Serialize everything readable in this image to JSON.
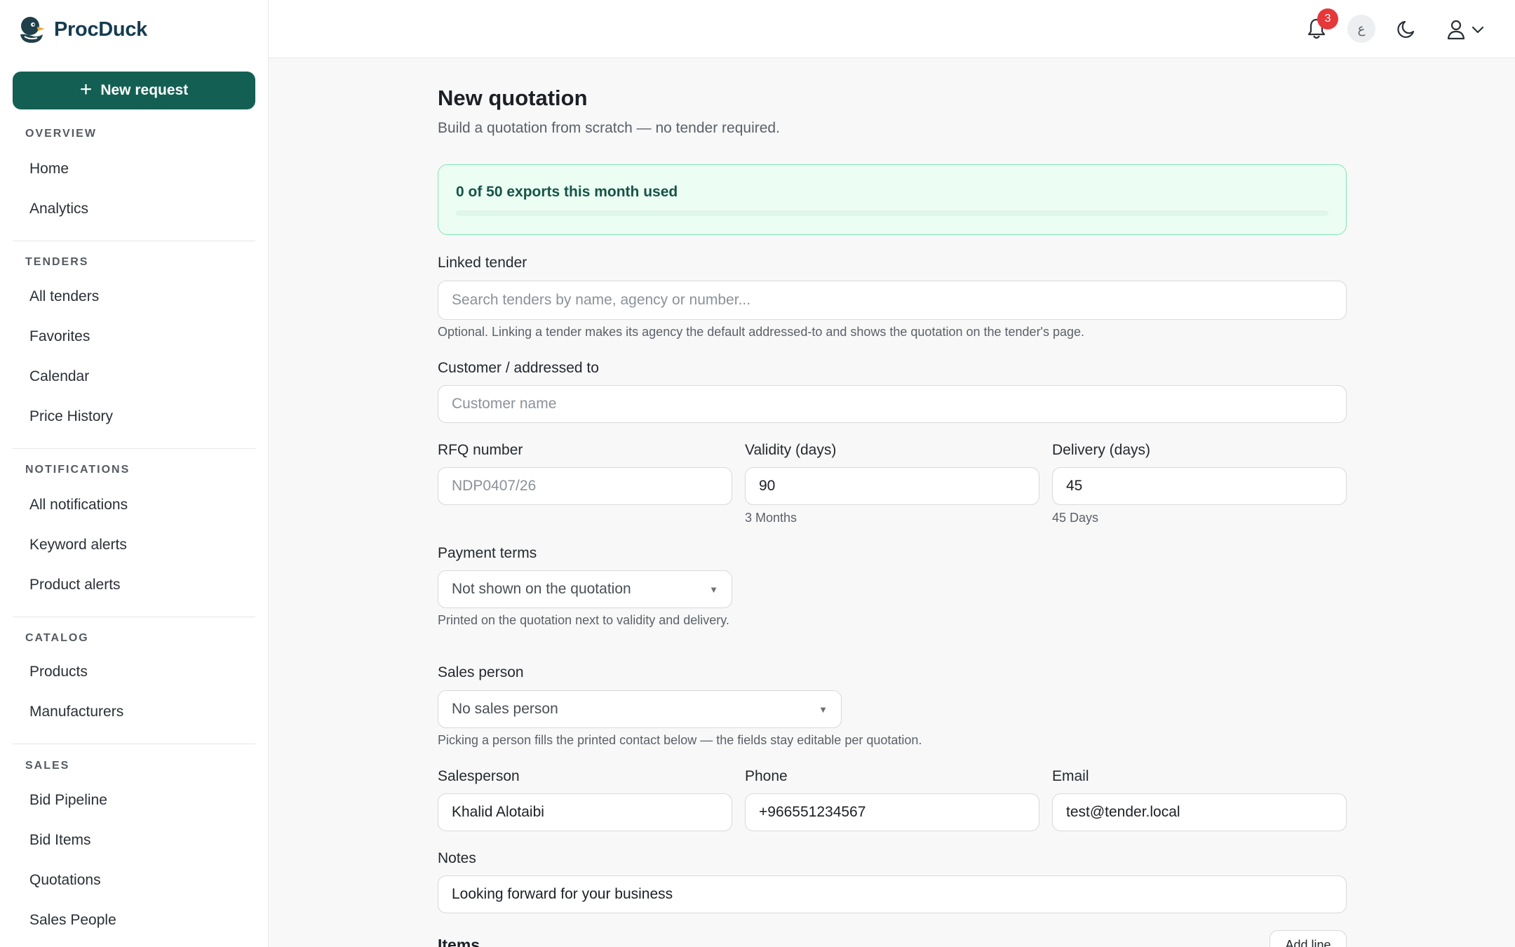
{
  "app": {
    "name": "ProcDuck",
    "logo_icon": "duck-logo-icon"
  },
  "sidebar": {
    "new_request_label": "New request",
    "sections": [
      {
        "title": "OVERVIEW",
        "items": [
          "Home",
          "Analytics"
        ]
      },
      {
        "title": "TENDERS",
        "items": [
          "All tenders",
          "Favorites",
          "Calendar",
          "Price History"
        ]
      },
      {
        "title": "NOTIFICATIONS",
        "items": [
          "All notifications",
          "Keyword alerts",
          "Product alerts"
        ]
      },
      {
        "title": "CATALOG",
        "items": [
          "Products",
          "Manufacturers"
        ]
      },
      {
        "title": "SALES",
        "items": [
          "Bid Pipeline",
          "Bid Items",
          "Quotations",
          "Sales People"
        ]
      }
    ]
  },
  "topbar": {
    "notification_count": "3",
    "language_label": "ع",
    "icons": [
      "bell-icon",
      "moon-icon",
      "user-icon",
      "chevron-down-icon"
    ]
  },
  "page": {
    "title": "New quotation",
    "subtitle": "Build a quotation from scratch — no tender required."
  },
  "quota": {
    "text": "0 of 50 exports this month used",
    "used": 0,
    "limit": 50
  },
  "form": {
    "linked_tender": {
      "label": "Linked tender",
      "placeholder": "Search tenders by name, agency or number...",
      "help": "Optional. Linking a tender makes its agency the default addressed-to and shows the quotation on the tender's page."
    },
    "customer": {
      "label": "Customer / addressed to",
      "placeholder": "Customer name"
    },
    "rfq": {
      "label": "RFQ number",
      "placeholder": "NDP0407/26"
    },
    "validity": {
      "label": "Validity (days)",
      "value": "90",
      "help": "3 Months"
    },
    "delivery": {
      "label": "Delivery (days)",
      "value": "45",
      "help": "45 Days"
    },
    "payment_terms": {
      "label": "Payment terms",
      "selected": "Not shown on the quotation",
      "help": "Printed on the quotation next to validity and delivery."
    },
    "sales_person": {
      "label": "Sales person",
      "selected": "No sales person",
      "help": "Picking a person fills the printed contact below — the fields stay editable per quotation."
    },
    "salesperson_name": {
      "label": "Salesperson",
      "value": "Khalid Alotaibi"
    },
    "phone": {
      "label": "Phone",
      "value": "+966551234567"
    },
    "email": {
      "label": "Email",
      "value": "test@tender.local"
    },
    "notes": {
      "label": "Notes",
      "value": "Looking forward for your business"
    }
  },
  "items": {
    "heading": "Items",
    "add_line_label": "Add line"
  },
  "colors": {
    "brand": "#135f54",
    "badge": "#e5383b",
    "quota_bg": "#ecfdf4",
    "quota_border": "#86e4b4"
  }
}
